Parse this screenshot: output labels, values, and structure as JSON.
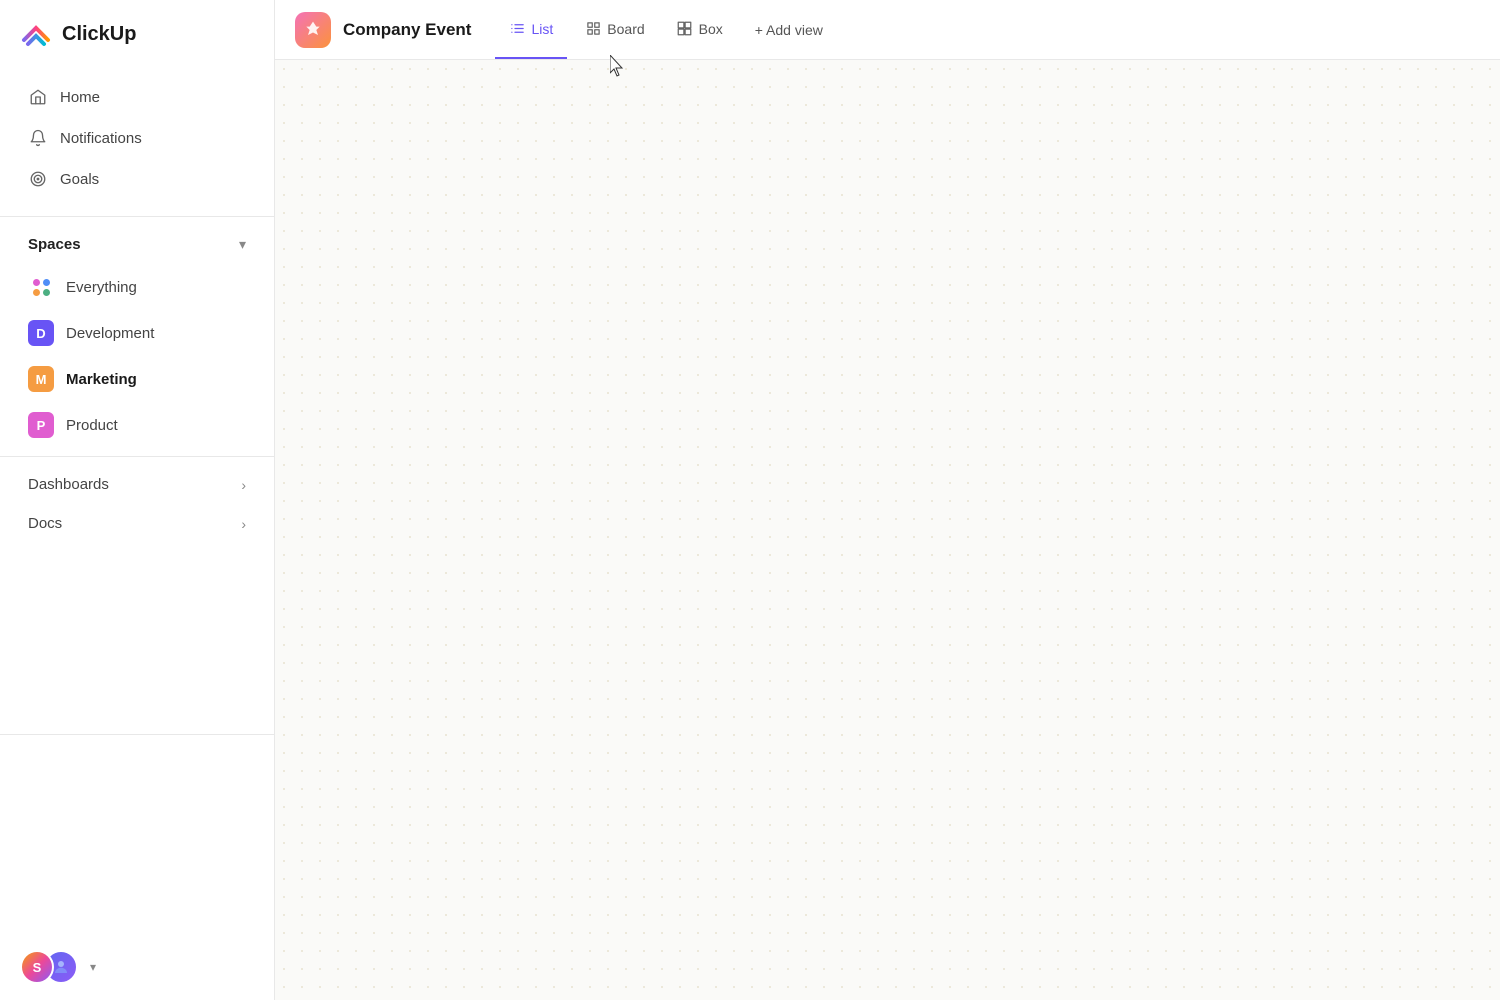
{
  "app": {
    "name": "ClickUp"
  },
  "sidebar": {
    "nav": [
      {
        "id": "home",
        "label": "Home",
        "icon": "home-icon"
      },
      {
        "id": "notifications",
        "label": "Notifications",
        "icon": "bell-icon"
      },
      {
        "id": "goals",
        "label": "Goals",
        "icon": "goals-icon"
      }
    ],
    "spaces_label": "Spaces",
    "spaces": [
      {
        "id": "everything",
        "label": "Everything",
        "type": "everything"
      },
      {
        "id": "development",
        "label": "Development",
        "type": "avatar",
        "color": "#6854f5",
        "letter": "D"
      },
      {
        "id": "marketing",
        "label": "Marketing",
        "type": "avatar",
        "color": "#f59c42",
        "letter": "M",
        "active": true
      },
      {
        "id": "product",
        "label": "Product",
        "type": "avatar",
        "color": "#e05dd0",
        "letter": "P"
      }
    ],
    "expandable": [
      {
        "id": "dashboards",
        "label": "Dashboards"
      },
      {
        "id": "docs",
        "label": "Docs"
      }
    ],
    "user": {
      "initials": "S",
      "chevron": "▾"
    }
  },
  "topbar": {
    "project_icon_alt": "company-event-icon",
    "project_title": "Company Event",
    "tabs": [
      {
        "id": "list",
        "label": "List",
        "icon": "list-icon",
        "active": true
      },
      {
        "id": "board",
        "label": "Board",
        "icon": "board-icon",
        "active": false
      },
      {
        "id": "box",
        "label": "Box",
        "icon": "box-icon",
        "active": false
      }
    ],
    "add_view_label": "+ Add view"
  }
}
